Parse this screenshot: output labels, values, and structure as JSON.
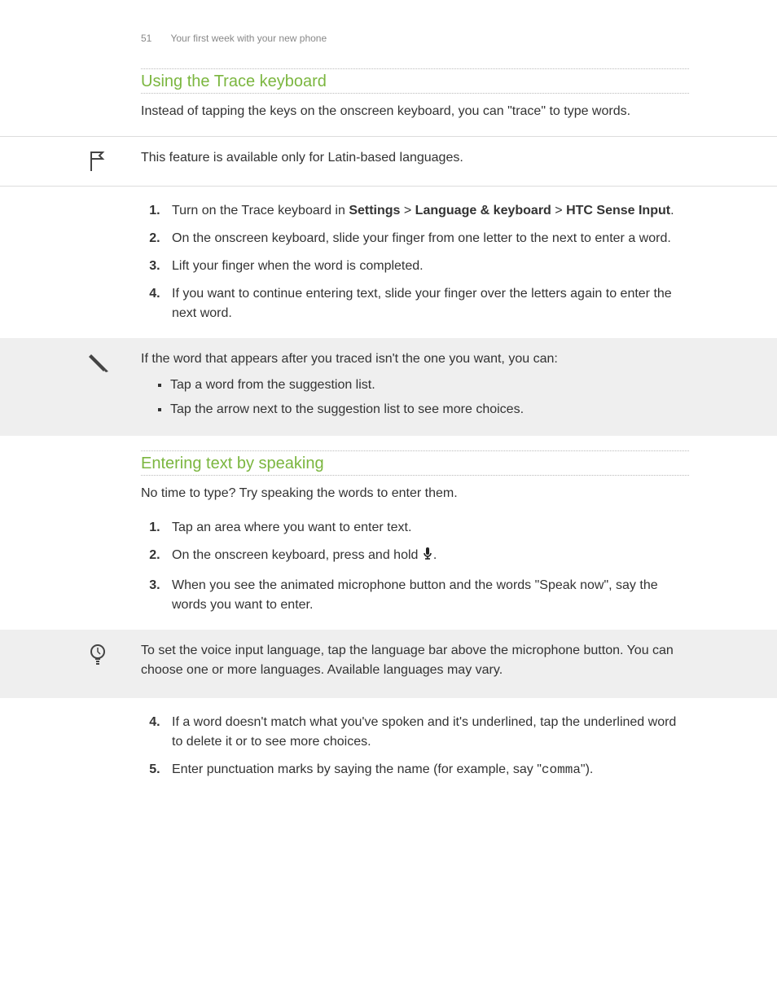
{
  "header": {
    "page_number": "51",
    "section": "Your first week with your new phone"
  },
  "s1": {
    "heading": "Using the Trace keyboard",
    "intro": "Instead of tapping the keys on the onscreen keyboard, you can \"trace\" to type words.",
    "flag_note": "This feature is available only for Latin-based languages.",
    "step1_a": "Turn on the Trace keyboard in ",
    "step1_b1": "Settings",
    "step1_c": " > ",
    "step1_b2": "Language & keyboard",
    "step1_d": " > ",
    "step1_b3": "HTC Sense Input",
    "step1_e": ".",
    "step2": "On the onscreen keyboard, slide your finger from one letter to the next to enter a word.",
    "step3": "Lift your finger when the word is completed.",
    "step4": "If you want to continue entering text, slide your finger over the letters again to enter the next word.",
    "note_intro": "If the word that appears after you traced isn't the one you want, you can:",
    "note_b1": "Tap a word from the suggestion list.",
    "note_b2": "Tap the arrow next to the suggestion list to see more choices."
  },
  "s2": {
    "heading": "Entering text by speaking",
    "intro": "No time to type? Try speaking the words to enter them.",
    "step1": "Tap an area where you want to enter text.",
    "step2_a": "On the onscreen keyboard, press and hold ",
    "step2_b": ".",
    "step3": "When you see the animated microphone button and the words \"Speak now\", say the words you want to enter.",
    "tip": "To set the voice input language, tap the language bar above the microphone button. You can choose one or more languages. Available languages may vary.",
    "step4": "If a word doesn't match what you've spoken and it's underlined, tap the underlined word to delete it or to see more choices.",
    "step5_a": "Enter punctuation marks by saying the name (for example, say \"",
    "step5_b": "comma",
    "step5_c": "\")."
  }
}
